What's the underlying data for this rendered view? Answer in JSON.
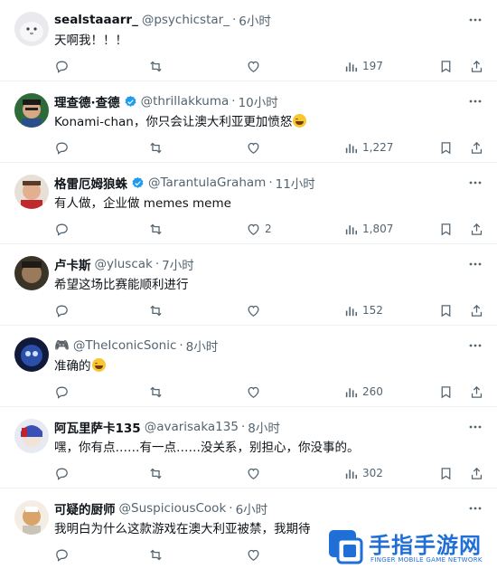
{
  "tweets": [
    {
      "name": "sealstaaarr_",
      "handle": "@psychicstar_",
      "time": "6小时",
      "text": "天啊我！！！",
      "reply_count": "",
      "retweet_count": "",
      "like_count": "",
      "views": "197",
      "verified": false
    },
    {
      "name": "理查德·查德",
      "handle": "@thrillakkuma",
      "time": "10小时",
      "text": "Konami-chan，你只会让澳大利亚更加愤怒",
      "emoji": "joy-emoji",
      "reply_count": "",
      "retweet_count": "",
      "like_count": "",
      "views": "1,227",
      "verified": true
    },
    {
      "name": "格雷厄姆狼蛛",
      "handle": "@TarantulaGraham",
      "time": "11小时",
      "text": "有人做，企业做 memes meme",
      "reply_count": "",
      "retweet_count": "",
      "like_count": "2",
      "views": "1,807",
      "verified": true
    },
    {
      "name": "卢卡斯",
      "handle": "@yluscak",
      "time": "7小时",
      "text": "希望这场比赛能顺利进行",
      "reply_count": "",
      "retweet_count": "",
      "like_count": "",
      "views": "152",
      "verified": false
    },
    {
      "name": "🎮",
      "handle": "@TheIconicSonic",
      "time": "8小时",
      "text": "准确的",
      "emoji": "grin-emoji",
      "reply_count": "",
      "retweet_count": "",
      "like_count": "",
      "views": "260",
      "verified": false
    },
    {
      "name": "阿瓦里萨卡135",
      "handle": "@avarisaka135",
      "time": "8小时",
      "text": "嘿，你有点……有一点……没关系，别担心，你没事的。",
      "reply_count": "",
      "retweet_count": "",
      "like_count": "",
      "views": "302",
      "verified": false
    },
    {
      "name": "可疑的厨师",
      "handle": "@SuspiciousCook",
      "time": "6小时",
      "text": "我明白为什么这款游戏在澳大利亚被禁，我期待",
      "reply_count": "",
      "retweet_count": "",
      "like_count": "",
      "views": "",
      "verified": false
    }
  ],
  "watermark": {
    "title": "手指手游网",
    "subtitle": "FINGER MOBILE GAME NETWORK"
  },
  "colors": {
    "text": "#0f1419",
    "secondary": "#536471",
    "verified": "#1d9bf0",
    "border": "#eff3f4",
    "watermark": "#1f6fd6"
  }
}
